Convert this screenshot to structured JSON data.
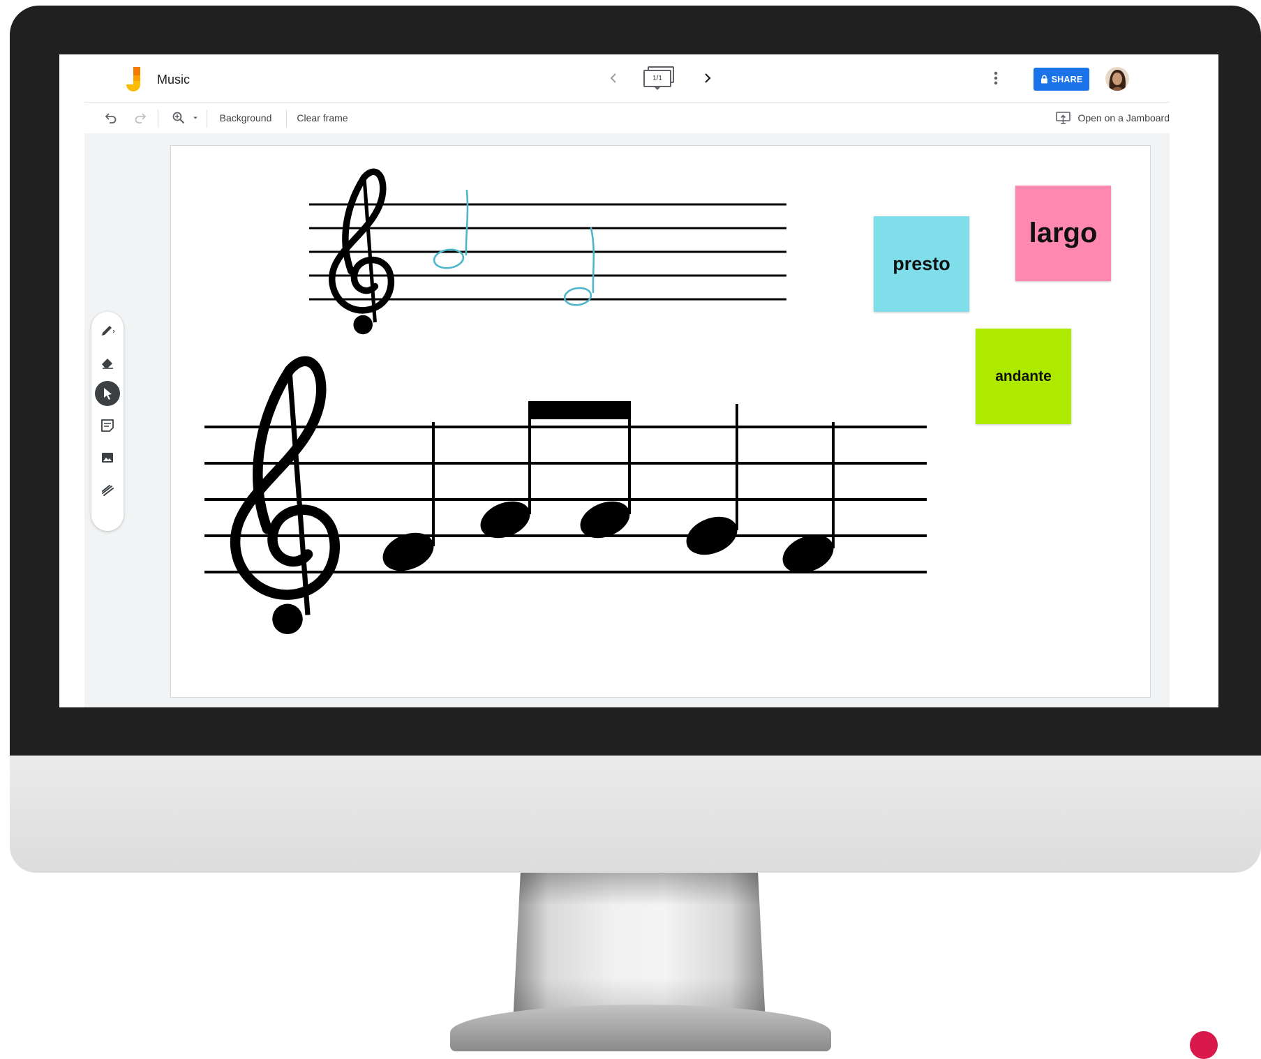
{
  "app": {
    "title": "Music"
  },
  "frame_nav": {
    "counter": "1/1"
  },
  "header": {
    "share_label": "SHARE"
  },
  "toolbar": {
    "background_label": "Background",
    "clear_frame_label": "Clear frame",
    "open_jamboard_label": "Open on a Jamboard"
  },
  "tools": [
    "pen-icon",
    "eraser-icon",
    "select-icon",
    "sticky-note-icon",
    "image-icon",
    "laser-icon"
  ],
  "active_tool": "select",
  "stickies": [
    {
      "label": "presto",
      "color": "#80deea"
    },
    {
      "label": "largo",
      "color": "#ff88b0"
    },
    {
      "label": "andante",
      "color": "#aeea00"
    }
  ],
  "colors": {
    "accent": "#1a73e8",
    "ink": "#4fb6c9",
    "bezel": "#202020"
  }
}
